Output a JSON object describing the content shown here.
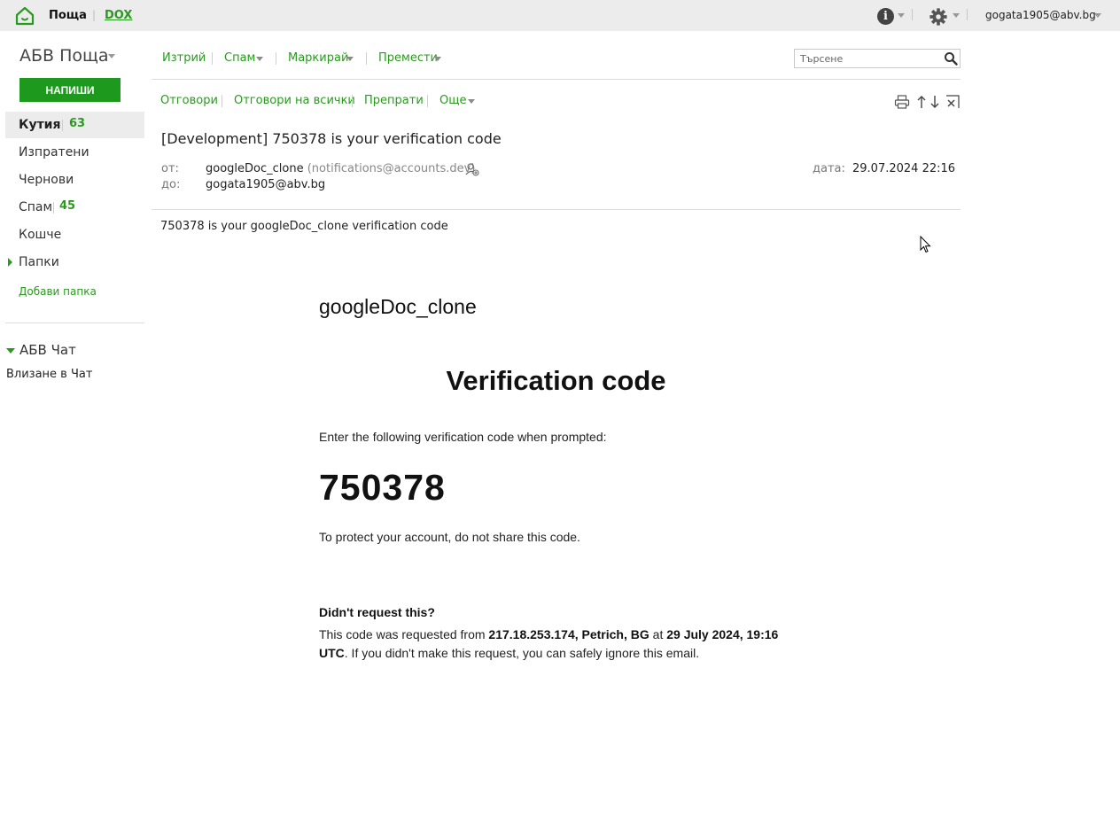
{
  "topbar": {
    "mail_label": "Поща",
    "dox_label": "DOX",
    "user_email": "gogata1905@abv.bg",
    "info_glyph": "i",
    "icons": [
      "home-icon",
      "info-icon",
      "gear-icon"
    ]
  },
  "sidebar": {
    "brand": "АБВ Поща",
    "compose_label": "НАПИШИ",
    "folders": [
      {
        "label": "Кутия",
        "count": "63"
      },
      {
        "label": "Изпратени",
        "count": ""
      },
      {
        "label": "Чернови",
        "count": ""
      },
      {
        "label": "Спам",
        "count": "45"
      },
      {
        "label": "Кошче",
        "count": ""
      },
      {
        "label": "Папки",
        "count": ""
      }
    ],
    "add_folder": "Добави папка",
    "chat_title": "АБВ Чат",
    "chat_login": "Влизане в Чат"
  },
  "toolbar": {
    "delete": "Изтрий",
    "spam": "Спам",
    "mark": "Маркирай",
    "move": "Премести",
    "search_placeholder": "Търсене"
  },
  "actions": {
    "reply": "Отговори",
    "reply_all": "Отговори на всички",
    "forward": "Препрати",
    "more": "Още",
    "icons": [
      "print-icon",
      "prev-message-icon",
      "next-message-icon",
      "close-message-icon"
    ]
  },
  "message": {
    "subject": "[Development] 750378 is your verification code",
    "from_label": "от:",
    "from_name": "googleDoc_clone",
    "from_email": "(notifications@accounts.dev)",
    "to_label": "до:",
    "to_email": "gogata1905@abv.bg",
    "date_label": "дата:",
    "date_value": "29.07.2024 22:16",
    "preview": "750378 is your googleDoc_clone verification code"
  },
  "email_body": {
    "app_name": "googleDoc_clone",
    "heading": "Verification code",
    "instruction": "Enter the following verification code when prompted:",
    "code": "750378",
    "warning": "To protect your account, do not share this code.",
    "question": "Didn't request this?",
    "note_prefix": "This code was requested from ",
    "note_location": "217.18.253.174, Petrich, BG",
    "note_at": " at ",
    "note_time": "29 July 2024, 19:16 UTC",
    "note_suffix": ". If you didn't make this request, you can safely ignore this email."
  },
  "colors": {
    "brand_green": "#2a9a1f",
    "compose_green": "#1d9a1d",
    "topbar_bg": "#ececec"
  }
}
